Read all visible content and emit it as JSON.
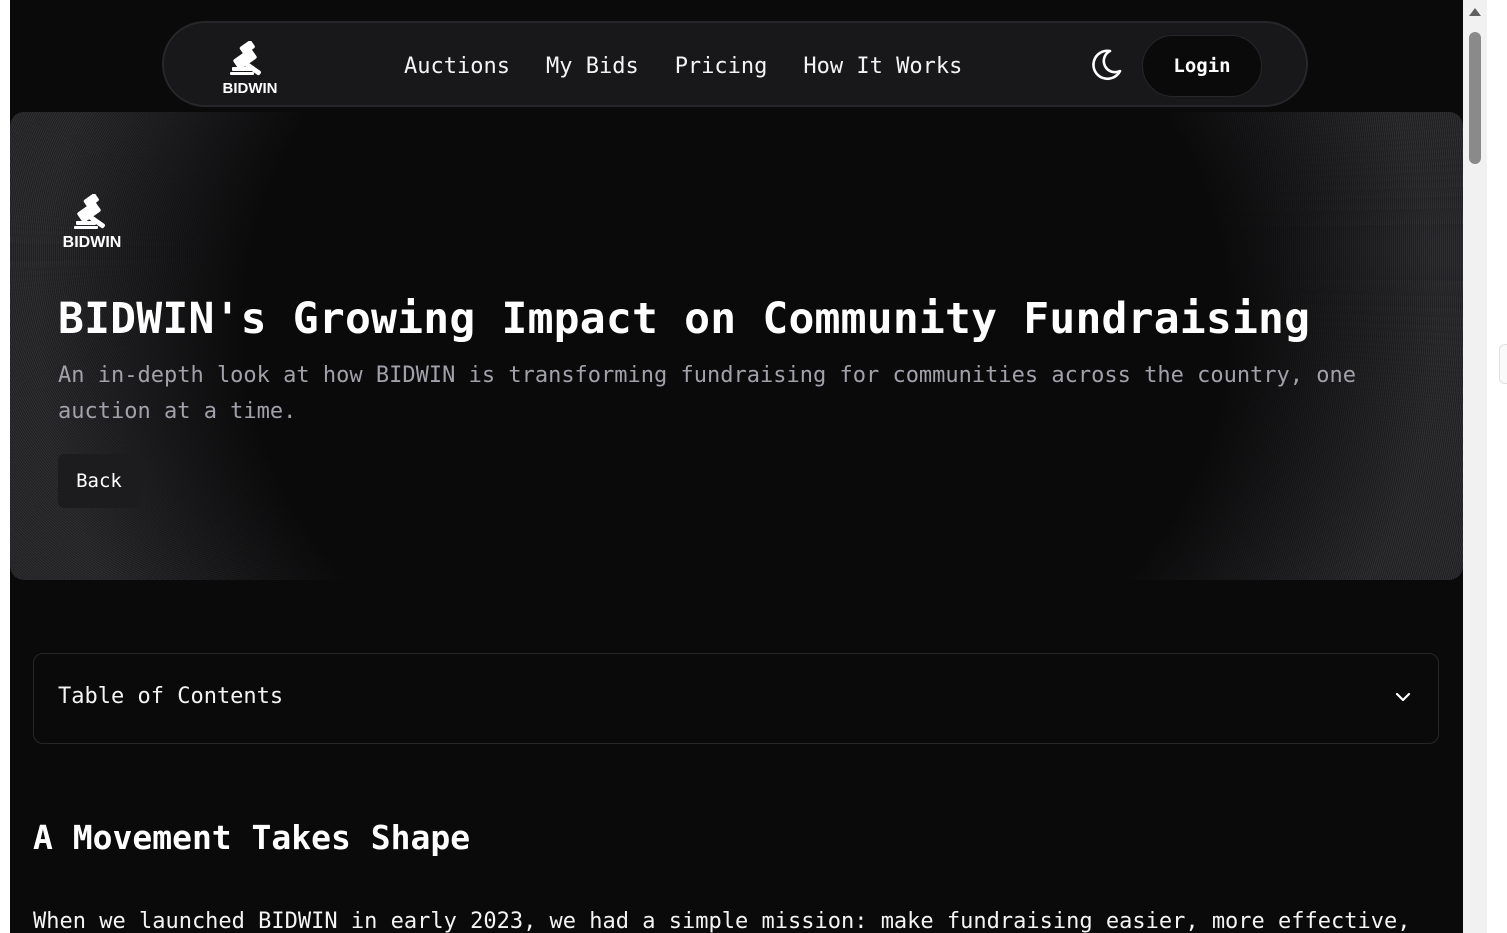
{
  "nav": {
    "logo_text": "BIDWIN",
    "links": [
      "Auctions",
      "My Bids",
      "Pricing",
      "How It Works"
    ],
    "theme_icon": "moon-icon",
    "login_label": "Login"
  },
  "hero": {
    "logo_text": "BIDWIN",
    "title": "BIDWIN's Growing Impact on Community Fundraising",
    "subtitle": "An in-depth look at how BIDWIN is transforming fundraising for communities across the country, one auction at a time.",
    "back_label": "Back"
  },
  "toc": {
    "label": "Table of Contents",
    "icon": "chevron-down-icon"
  },
  "article": {
    "heading": "A Movement Takes Shape",
    "paragraph": "When we launched BIDWIN in early 2023, we had a simple mission: make fundraising easier, more effective,"
  },
  "colors": {
    "background": "#0a0a0b",
    "nav_bg": "#18181b",
    "border": "#27272a",
    "muted_text": "#a1a1aa"
  }
}
